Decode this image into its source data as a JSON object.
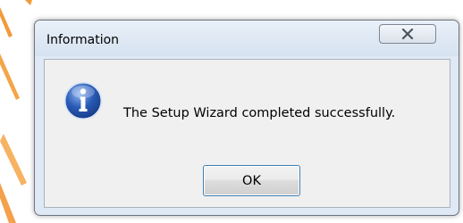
{
  "dialog": {
    "title": "Information",
    "message": "The Setup Wizard completed successfully.",
    "ok_label": "OK",
    "close_icon": "close-icon",
    "message_icon": "info-icon"
  },
  "colors": {
    "icon_blue": "#2a5bb7",
    "ok_focus_border": "#3c7fb1",
    "desktop_accent": "#f29a3a"
  }
}
